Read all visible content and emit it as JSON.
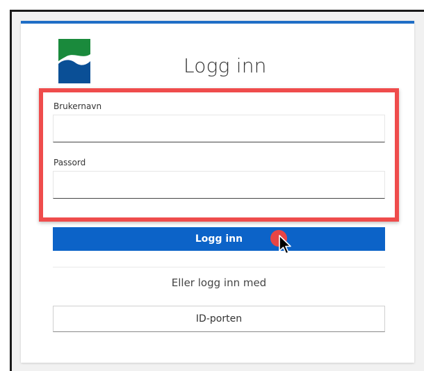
{
  "login": {
    "title": "Logg inn",
    "username_label": "Brukernavn",
    "username_value": "",
    "password_label": "Passord",
    "password_value": "",
    "submit_label": "Logg inn",
    "alt_login_text": "Eller logg inn med",
    "idporten_label": "ID-porten"
  },
  "icons": {
    "logo": "brand-logo-icon",
    "cursor": "mouse-pointer-icon"
  },
  "colors": {
    "accent": "#0c63c8",
    "top_border": "#1f6ec6",
    "highlight": "#ef4c4c",
    "logo_green": "#1a8a3c",
    "logo_blue": "#0a4f96",
    "click_dot": "#e84545"
  }
}
